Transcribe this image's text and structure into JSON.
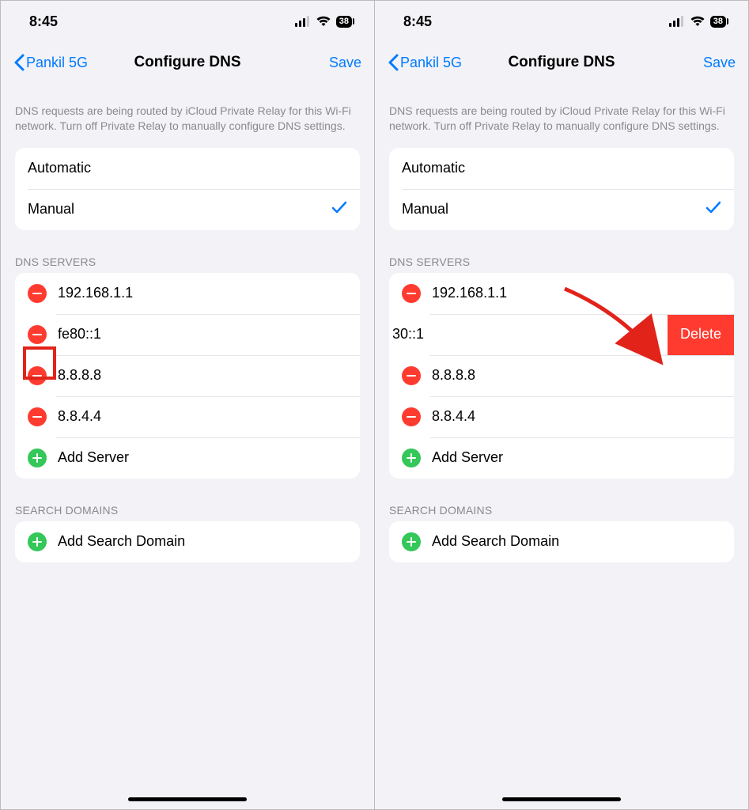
{
  "status": {
    "time": "8:45",
    "battery": "38"
  },
  "nav": {
    "back": "Pankil 5G",
    "title": "Configure DNS",
    "save": "Save"
  },
  "info": "DNS requests are being routed by iCloud Private Relay for this Wi-Fi network. Turn off Private Relay to manually configure DNS settings.",
  "mode": {
    "automatic": "Automatic",
    "manual": "Manual"
  },
  "sections": {
    "dns": "DNS SERVERS",
    "search": "SEARCH DOMAINS"
  },
  "servers": [
    "192.168.1.1",
    "fe80::1",
    "8.8.8.8",
    "8.8.4.4"
  ],
  "swiped_server_fragment": "30::1",
  "add_server": "Add Server",
  "add_search": "Add Search Domain",
  "delete": "Delete"
}
